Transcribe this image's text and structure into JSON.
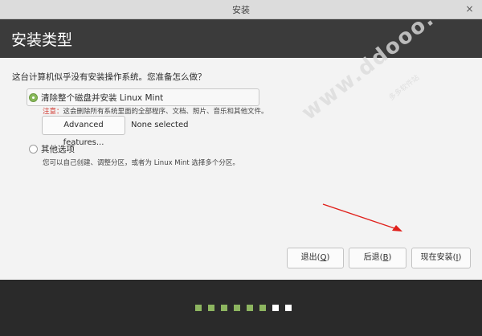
{
  "window": {
    "title": "安装",
    "close_glyph": "×"
  },
  "header": {
    "title": "安装类型"
  },
  "question": "这台计算机似乎没有安装操作系统。您准备怎么做？",
  "option_erase": {
    "label": "清除整个磁盘并安装 Linux Mint",
    "selected": true,
    "note_prefix": "注意：",
    "note_text": "这会删除所有系统里面的全部程序、文档、照片、音乐和其他文件。"
  },
  "advanced": {
    "button_label": "Advanced features...",
    "status": "None selected"
  },
  "option_other": {
    "label": "其他选项",
    "selected": false,
    "description": "您可以自己创建、调整分区，或者为 Linux Mint 选择多个分区。"
  },
  "buttons": {
    "quit_label": "退出(",
    "quit_key": "Q",
    "quit_end": ")",
    "back_label": "后退(",
    "back_key": "B",
    "back_end": ")",
    "install_label": "现在安装(",
    "install_key": "I",
    "install_end": ")"
  },
  "progress": {
    "completed_steps": 6,
    "total_steps": 8
  },
  "colors": {
    "accent": "#8db560",
    "header": "#3b3b3b",
    "annotation_arrow": "#e0201b"
  },
  "watermark": {
    "text": "多多软件站",
    "domain": "www.ddooo.com"
  }
}
